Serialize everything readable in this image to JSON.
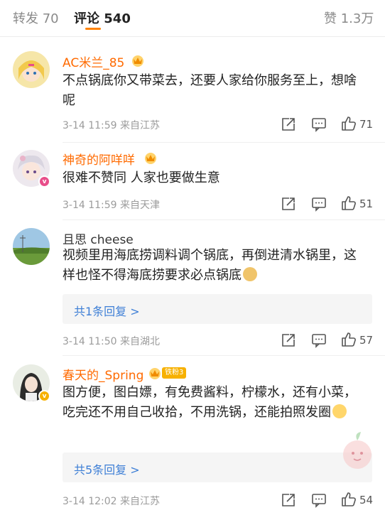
{
  "tabs": {
    "repost": {
      "label": "转发",
      "count": "70"
    },
    "comment": {
      "label": "评论",
      "count": "540"
    },
    "like": {
      "label": "赞",
      "count": "1.3万"
    }
  },
  "comments": [
    {
      "user": "AC米兰_85",
      "text": "不点锅底你又带菜去，还要人家给你服务至上，想啥呢",
      "time": "3-14 11:59",
      "source": "来自江苏",
      "likes": "71"
    },
    {
      "user": "神奇的阿咩咩",
      "text": "很难不赞同 人家也要做生意",
      "time": "3-14 11:59",
      "source": "来自天津",
      "likes": "51"
    },
    {
      "user": "且思 cheese",
      "text": "视频里用海底捞调料调个锅底，再倒进清水锅里，这样也怪不得海底捞要求必点锅底",
      "reply_link": "共1条回复 >",
      "time": "3-14 11:50",
      "source": "来自湖北",
      "likes": "57"
    },
    {
      "user": "春天的_Spring",
      "fan_badge": "铁粉3",
      "text": "图方便，图白嫖，有免费酱料，柠檬水，还有小菜，吃完还不用自己收拾，不用洗锅，还能拍照发圈",
      "reply_link": "共5条回复 >",
      "time": "3-14 12:02",
      "source": "来自江苏",
      "likes": "54"
    }
  ],
  "icons": {
    "share": "share-icon",
    "comment": "comment-icon",
    "like": "thumbs-up-icon",
    "crown": "crown-badge-icon",
    "emoji_doge": "doge-emoji-icon",
    "emoji_sweat": "sweat-emoji-icon"
  },
  "colors": {
    "accent": "#ff8200",
    "username": "#ff6a00",
    "link": "#3e7fd6",
    "meta": "#9b9b9b"
  }
}
